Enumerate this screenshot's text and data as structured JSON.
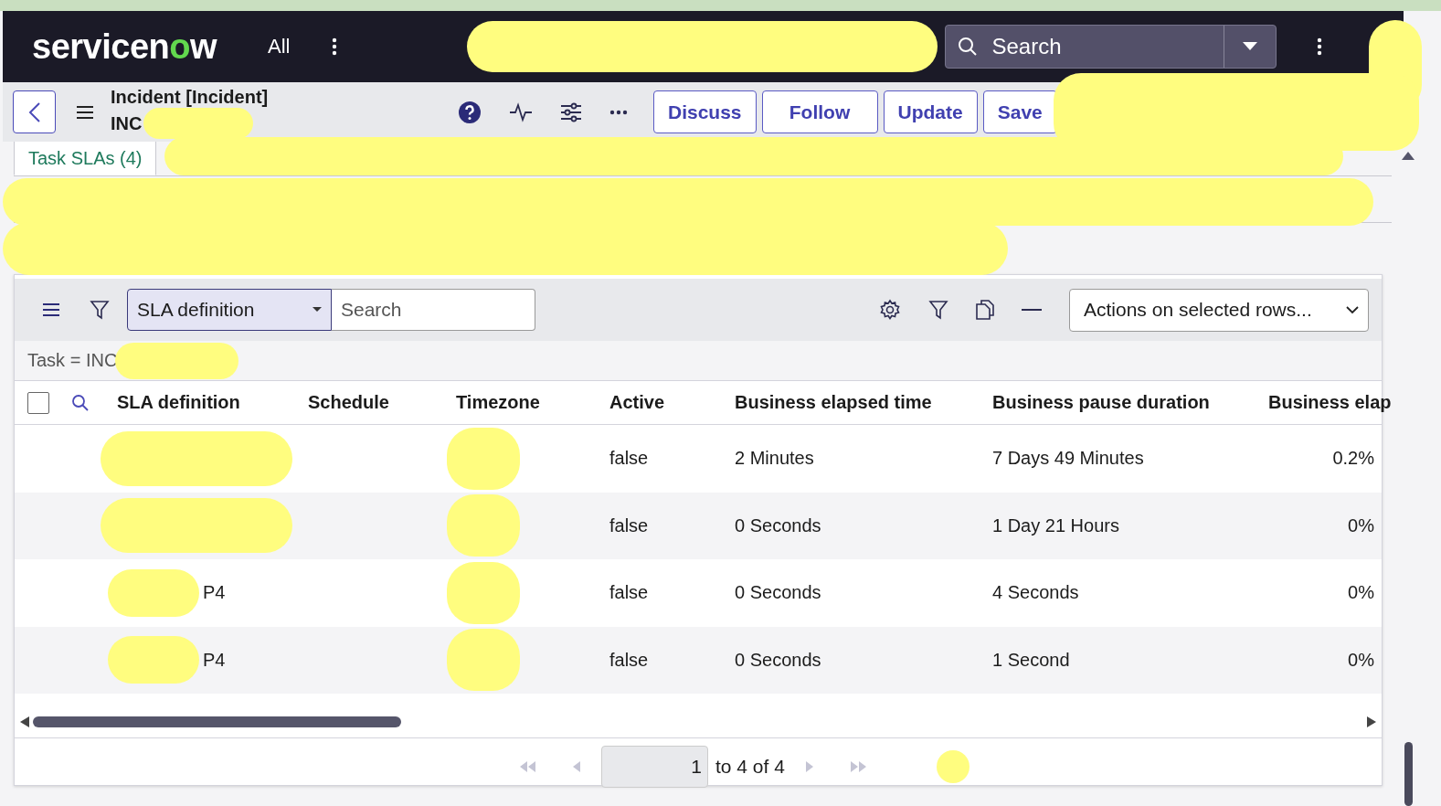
{
  "header": {
    "logo": "servicenow",
    "menu": "All",
    "scope_redacted": true,
    "search": {
      "placeholder": "Search"
    },
    "profile_redacted": true
  },
  "form": {
    "title": "Incident [Incident]",
    "number": "INC",
    "number_redacted": true,
    "buttons": [
      "Discuss",
      "Follow",
      "Update",
      "Save"
    ],
    "more_redacted": true
  },
  "related_tabs": {
    "tabs": [
      {
        "label": "Task SLAs (4)",
        "selected": true
      }
    ],
    "redacted": true
  },
  "list": {
    "group_by": "SLA definition",
    "search": {
      "placeholder": "Search"
    },
    "actions": "Actions on selected rows...",
    "filter": {
      "text": "Task = INC",
      "redacted": true
    },
    "select_all": {
      "checked": false
    },
    "columns": [
      "SLA definition",
      "Schedule",
      "Timezone",
      "Active",
      "Business elapsed time",
      "Business pause duration",
      "Business elap"
    ],
    "rows": [
      {
        "sla": {
          "redacted": true
        },
        "timezone": {
          "redacted": true
        },
        "active": "false",
        "elapsed": "2 Minutes",
        "pause": "7 Days 49 Minutes",
        "percent": "0.2%"
      },
      {
        "sla": {
          "redacted": true
        },
        "timezone": {
          "redacted": true
        },
        "active": "false",
        "elapsed": "0 Seconds",
        "pause": "1 Day 21 Hours",
        "percent": "0%"
      },
      {
        "sla": {
          "text": "P4",
          "redacted": true
        },
        "timezone": {
          "redacted": true
        },
        "active": "false",
        "elapsed": "0 Seconds",
        "pause": "4 Seconds",
        "percent": "0%"
      },
      {
        "sla": {
          "text": "P4",
          "redacted": true
        },
        "timezone": {
          "redacted": true
        },
        "active": "false",
        "elapsed": "0 Seconds",
        "pause": "1 Second",
        "percent": "0%"
      }
    ],
    "pagination": {
      "page": "1",
      "range": "to 4 of 4",
      "redacted": true
    }
  }
}
